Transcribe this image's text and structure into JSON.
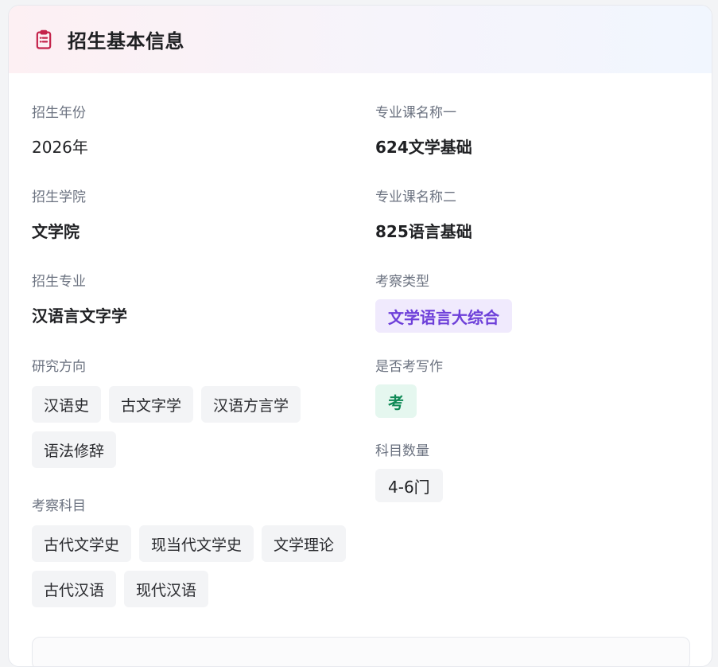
{
  "header": {
    "title": "招生基本信息",
    "icon": "clipboard-icon",
    "icon_color": "#c4234b"
  },
  "left": {
    "year": {
      "label": "招生年份",
      "value": "2026年"
    },
    "college": {
      "label": "招生学院",
      "value": "文学院"
    },
    "major": {
      "label": "招生专业",
      "value": "汉语言文字学"
    },
    "directions": {
      "label": "研究方向",
      "items": [
        "汉语史",
        "古文字学",
        "汉语方言学",
        "语法修辞"
      ]
    },
    "subjects": {
      "label": "考察科目",
      "items": [
        "古代文学史",
        "现当代文学史",
        "文学理论",
        "古代汉语",
        "现代汉语"
      ]
    }
  },
  "right": {
    "course1": {
      "label": "专业课名称一",
      "value": "624文学基础"
    },
    "course2": {
      "label": "专业课名称二",
      "value": "825语言基础"
    },
    "exam_type": {
      "label": "考察类型",
      "value": "文学语言大综合"
    },
    "writing": {
      "label": "是否考写作",
      "value": "考"
    },
    "subject_count": {
      "label": "科目数量",
      "value": "4-6门"
    }
  }
}
